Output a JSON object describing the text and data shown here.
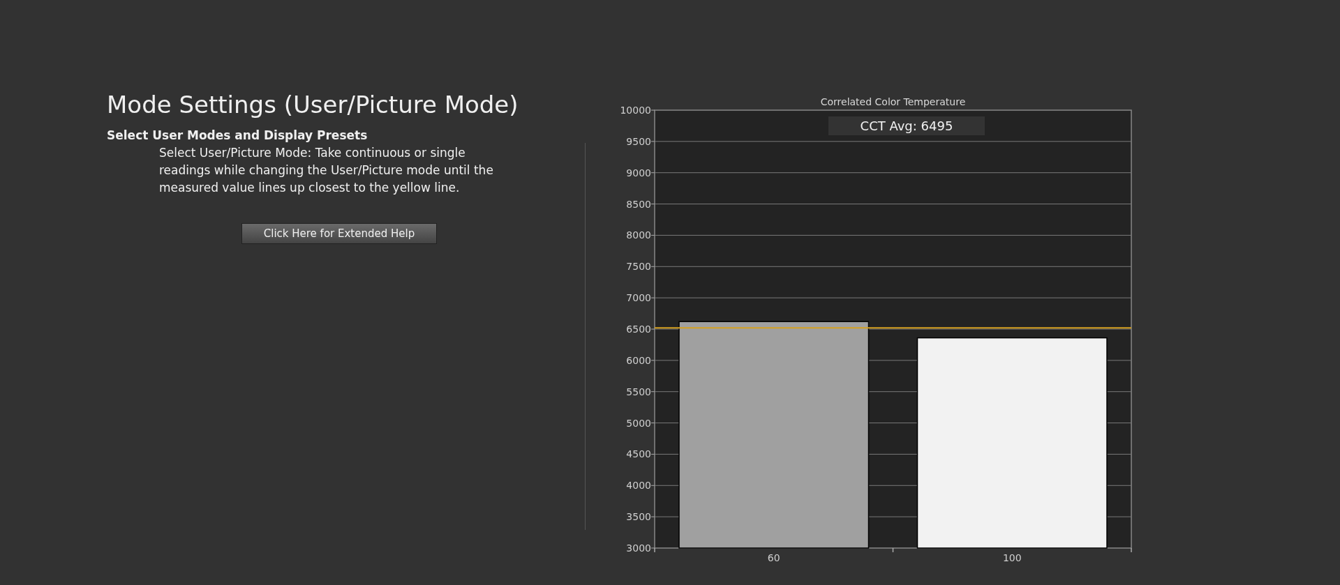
{
  "heading": "Mode Settings (User/Picture Mode)",
  "subheading": "Select User Modes and Display Presets",
  "description": "Select User/Picture Mode: Take continuous or single readings while changing the User/Picture mode until the measured value lines up closest to the yellow line.",
  "help_button": "Click Here for Extended Help",
  "chart": {
    "average_label": "CCT Avg: 6495",
    "chart_data": {
      "type": "bar",
      "title": "Correlated Color Temperature",
      "categories": [
        "60",
        "100"
      ],
      "series": [
        {
          "color": "#a0a0a0",
          "values": [
            6620,
            null
          ]
        },
        {
          "color": "#f2f2f2",
          "values": [
            null,
            6360
          ]
        }
      ],
      "stacked": true,
      "grid": true,
      "ylim": [
        3000,
        10000
      ],
      "yticks": [
        3000,
        3500,
        4000,
        4500,
        5000,
        5500,
        6000,
        6500,
        7000,
        7500,
        8000,
        8500,
        9000,
        9500,
        10000
      ],
      "ref_lines": [
        {
          "axis": "y",
          "value": 6520,
          "color": "#d4a020"
        }
      ]
    }
  }
}
